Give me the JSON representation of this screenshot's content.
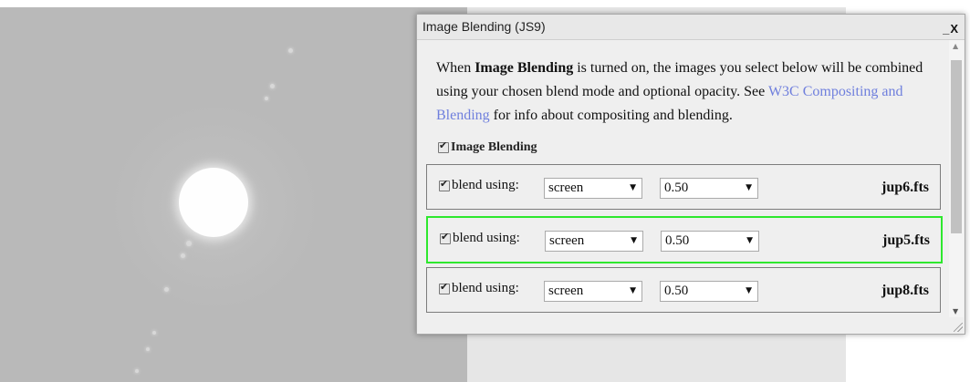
{
  "dialog": {
    "title": "Image Blending (JS9)",
    "minimize_label": "_",
    "close_label": "X"
  },
  "intro": {
    "text_before": "When ",
    "bold": "Image Blending",
    "text_middle": " is turned on, the images you select below will be combined using your chosen blend mode and optional opacity. See ",
    "link": "W3C Compositing and Blending",
    "text_after": " for info about compositing and blending."
  },
  "master_toggle": {
    "label": "Image Blending",
    "checked": true
  },
  "rows": [
    {
      "checked": true,
      "label": "blend using:",
      "mode": "screen",
      "opacity": "0.50",
      "file": "jup6.fts",
      "active": false
    },
    {
      "checked": true,
      "label": "blend using:",
      "mode": "screen",
      "opacity": "0.50",
      "file": "jup5.fts",
      "active": true
    },
    {
      "checked": true,
      "label": "blend using:",
      "mode": "screen",
      "opacity": "0.50",
      "file": "jup8.fts",
      "active": false
    }
  ],
  "colors": {
    "active_border": "#2ee82e",
    "link": "#6f7fdd",
    "image_background": "#b9b9b9"
  }
}
